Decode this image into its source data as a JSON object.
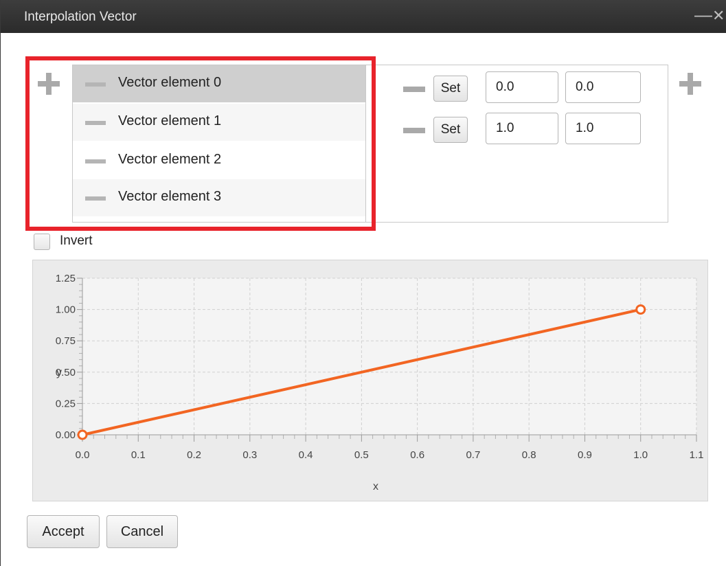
{
  "window": {
    "title": "Interpolation Vector",
    "minimize_glyph": "—",
    "close_glyph": "✕"
  },
  "list": {
    "items": [
      {
        "label": "Vector element 0",
        "selected": true
      },
      {
        "label": "Vector element 1",
        "selected": false
      },
      {
        "label": "Vector element 2",
        "selected": false
      },
      {
        "label": "Vector element 3",
        "selected": false
      }
    ]
  },
  "vector_rows": [
    {
      "set_label": "Set",
      "x": "0.0",
      "y": "0.0"
    },
    {
      "set_label": "Set",
      "x": "1.0",
      "y": "1.0"
    }
  ],
  "invert": {
    "label": "Invert",
    "checked": false
  },
  "chart_data": {
    "type": "line",
    "xlabel": "x",
    "ylabel": "y",
    "x_ticks": [
      "0.0",
      "0.1",
      "0.2",
      "0.3",
      "0.4",
      "0.5",
      "0.6",
      "0.7",
      "0.8",
      "0.9",
      "1.0",
      "1.1"
    ],
    "y_ticks": [
      "0.00",
      "0.25",
      "0.50",
      "0.75",
      "1.00",
      "1.25"
    ],
    "xlim": [
      0,
      1.1
    ],
    "ylim": [
      0,
      1.25
    ],
    "series": [
      {
        "x": [
          0.0,
          1.0
        ],
        "y": [
          0.0,
          1.0
        ],
        "color": "#f26522"
      }
    ],
    "grid": true
  },
  "buttons": {
    "accept": "Accept",
    "cancel": "Cancel"
  },
  "colors": {
    "highlight": "#e8232b",
    "series": "#f26522",
    "titlebar": "#333333"
  }
}
